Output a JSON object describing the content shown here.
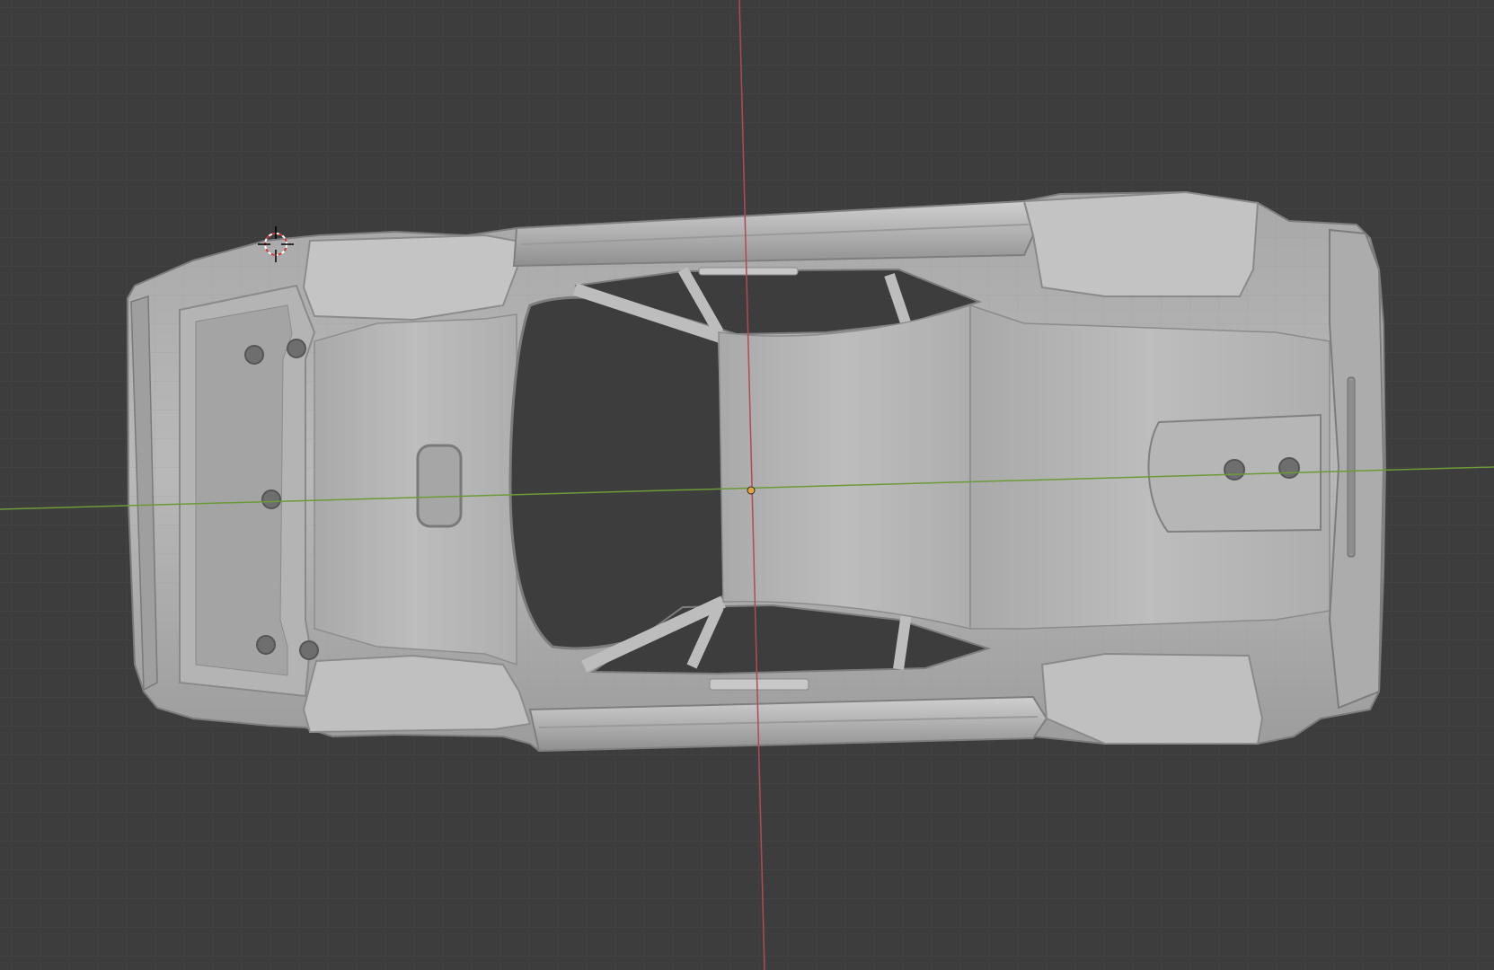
{
  "app": "3D viewport",
  "viewport": {
    "view": "bottom",
    "object": "car-body-underside",
    "shading": "solid"
  },
  "colors": {
    "background": "#3d3d3d",
    "grid_minor": "#4a4a4a",
    "grid_major": "#555555",
    "axis_x": "#6c9a38",
    "axis_y": "#b34a50",
    "mesh": "#b8b8b8",
    "mesh_shadow": "#8e8e8e",
    "mesh_highlight": "#d4d4d4",
    "cursor": "#d33b3b"
  },
  "icons": {
    "cursor": "3d-cursor-icon",
    "origin": "object-origin-icon"
  }
}
